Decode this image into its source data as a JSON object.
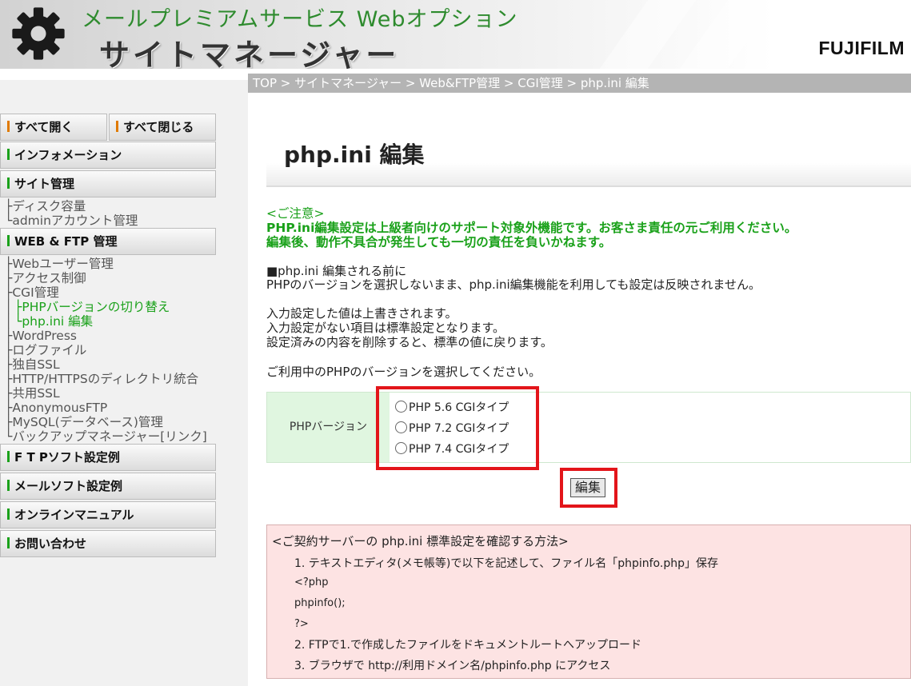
{
  "header": {
    "subtitle": "メールプレミアムサービス Webオプション",
    "title": "サイトマネージャー",
    "brand": "FUJIFILM",
    "gear_icon": "gear-icon"
  },
  "breadcrumb": "TOP > サイトマネージャー > Web&FTP管理 > CGI管理 > php.ini 編集",
  "sidebar": {
    "open_all": "すべて開く",
    "close_all": "すべて閉じる",
    "information": "インフォメーション",
    "site_admin": "サイト管理",
    "site_items": [
      "ディスク容量",
      "adminアカウント管理"
    ],
    "web_ftp": "WEB & FTP 管理",
    "web_items": [
      "Webユーザー管理",
      "アクセス制御",
      "CGI管理"
    ],
    "cgi_items": [
      "PHPバージョンの切り替え",
      "php.ini 編集"
    ],
    "web_items2": [
      "WordPress",
      "ログファイル",
      "独自SSL",
      "HTTP/HTTPSのディレクトリ統合",
      "共用SSL",
      "AnonymousFTP",
      "MySQL(データベース)管理",
      "バックアップマネージャー[リンク]"
    ],
    "ftp_soft": "F T Pソフト設定例",
    "mail_soft": "メールソフト設定例",
    "manual": "オンラインマニュアル",
    "contact": "お問い合わせ",
    "accent_color": "#e07a00"
  },
  "main": {
    "page_title": "php.ini 編集",
    "warn_head": "<ご注意>",
    "warn_line1": "PHP.ini編集設定は上級者向けのサポート対象外機能です。お客さま責任の元ご利用ください。",
    "warn_line2": "編集後、動作不具合が発生しても一切の責任を負いかねます。",
    "before_head": "■php.ini 編集される前に",
    "before_text": "PHPのバージョンを選択しないまま、php.ini編集機能を利用しても設定は反映されません。",
    "note1": "入力設定した値は上書きされます。",
    "note2": "入力設定がない項目は標準設定となります。",
    "note3": "設定済みの内容を削除すると、標準の値に戻ります。",
    "select_prompt": "ご利用中のPHPのバージョンを選択してください。",
    "version_label": "PHPバージョン",
    "versions": [
      "PHP 5.6 CGIタイプ",
      "PHP 7.2 CGIタイプ",
      "PHP 7.4 CGIタイプ"
    ],
    "edit_button": "編集",
    "info": {
      "title": "<ご契約サーバーの php.ini 標準設定を確認する方法>",
      "step1": "1. テキストエディタ(メモ帳等)で以下を記述して、ファイル名「phpinfo.php」保存",
      "code1": "<?php",
      "code2": "phpinfo();",
      "code3": "?>",
      "step2": "2. FTPで1.で作成したファイルをドキュメントルートへアップロード",
      "step3": "3. ブラウザで http://利用ドメイン名/phpinfo.php にアクセス"
    }
  }
}
